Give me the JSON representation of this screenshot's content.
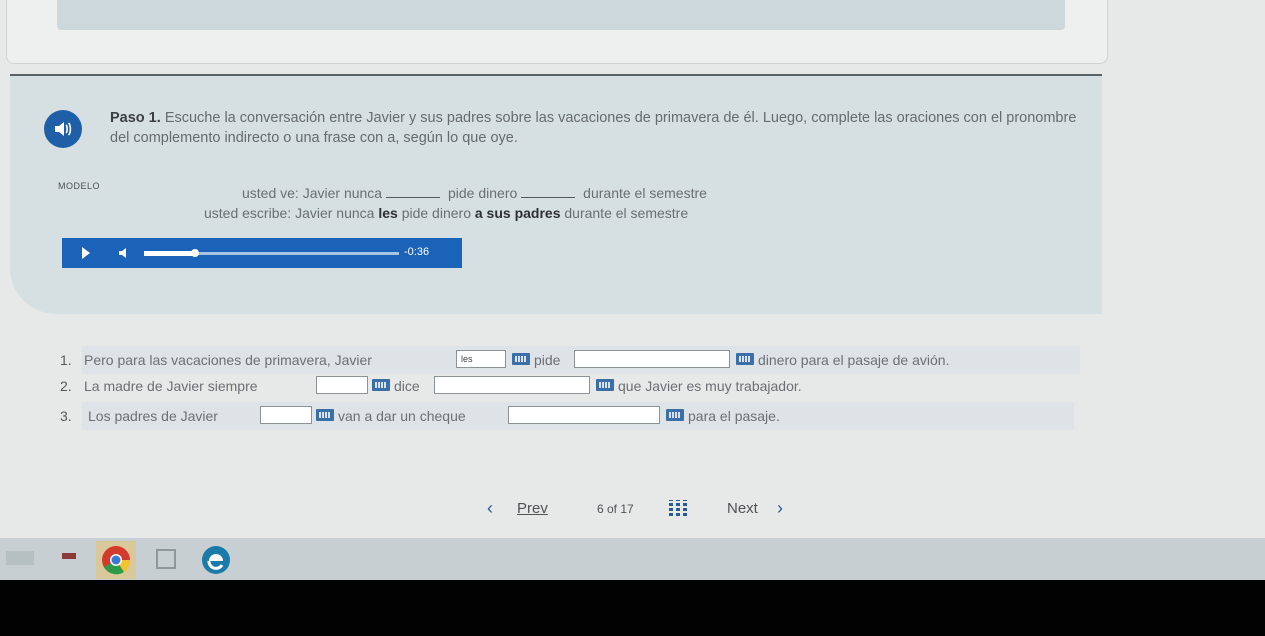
{
  "instructions": {
    "step_label": "Paso 1.",
    "step_text": "Escuche la conversación entre Javier y sus padres sobre las vacaciones de primavera de él. Luego, complete las oraciones con el pronombre del complemento indirecto o una frase con a, según lo que oye."
  },
  "model": {
    "label": "MODELO",
    "line1_a": "usted ve:",
    "line1_b": "Javier nunca",
    "line1_c": "pide dinero",
    "line1_d": "durante el semestre",
    "line2_a": "usted escribe:",
    "line2_b": "Javier nunca",
    "line2_bold1": "les",
    "line2_c": "pide dinero",
    "line2_bold2": "a sus padres",
    "line2_d": "durante el semestre"
  },
  "audio_player": {
    "time": "-0:36",
    "progress_fraction": 0.2,
    "colors": {
      "bar": "#1b63b8"
    }
  },
  "questions": [
    {
      "number": "1.",
      "text1": "Pero para las vacaciones de primavera, Javier",
      "field1_value": "les",
      "text2": "pide",
      "field2_value": "",
      "text3": "dinero para el pasaje de avión."
    },
    {
      "number": "2.",
      "text1": "La madre de Javier siempre",
      "field1_value": "",
      "text2": "dice",
      "field2_value": "",
      "text3": "que Javier es muy trabajador."
    },
    {
      "number": "3.",
      "text1": "Los padres de Javier",
      "field1_value": "",
      "text2": "van a dar un cheque",
      "field2_value": "",
      "text3": "para el pasaje."
    }
  ],
  "pager": {
    "prev_label": "Prev",
    "page_text": "6 of 17",
    "next_label": "Next"
  },
  "taskbar": {
    "items": [
      "file-icon",
      "chrome-icon",
      "calendar-icon",
      "edge-icon"
    ]
  }
}
